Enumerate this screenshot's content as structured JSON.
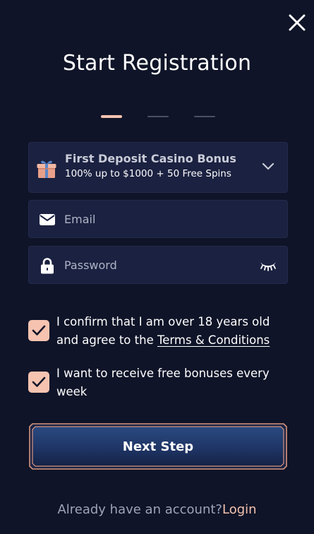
{
  "modal": {
    "title": "Start Registration",
    "steps_total": 3,
    "current_step": 1
  },
  "bonus": {
    "title": "First Deposit Casino Bonus",
    "subtitle": "100% up to $1000 + 50 Free Spins",
    "icon": "gift-icon"
  },
  "form": {
    "email_placeholder": "Email",
    "email_value": "",
    "password_placeholder": "Password",
    "password_value": ""
  },
  "consents": {
    "age_prefix": "I confirm that I am over 18 years old and agree to the ",
    "terms_link": "Terms & Conditions",
    "age_checked": true,
    "bonuses_text": "I want to receive free bonuses every week",
    "bonuses_checked": true
  },
  "actions": {
    "next_label": "Next Step"
  },
  "footer": {
    "prompt": "Already have an account?",
    "login_link": "Login"
  },
  "colors": {
    "background": "#0f1428",
    "field_background": "#1b2140",
    "accent": "#f5c3b0",
    "button_border": "#d9957e"
  }
}
